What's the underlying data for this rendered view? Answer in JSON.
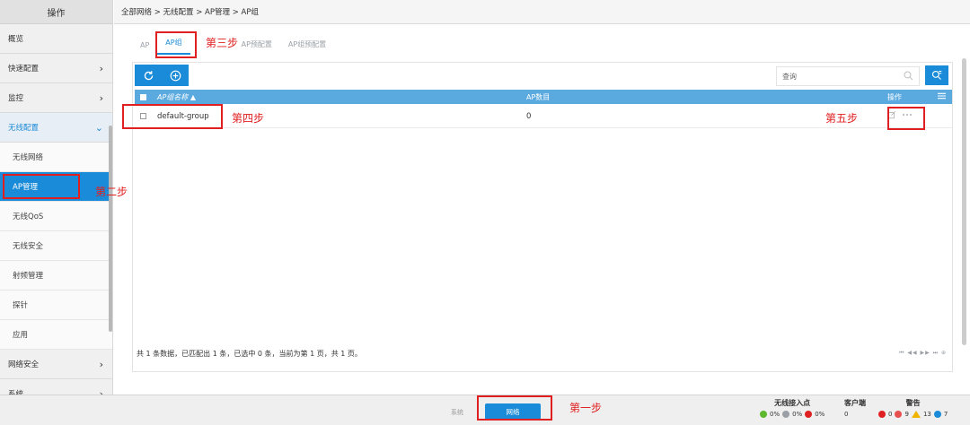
{
  "sidebar": {
    "header": "操作",
    "items": [
      {
        "label": "概览"
      },
      {
        "label": "快速配置",
        "chevron": "›"
      },
      {
        "label": "监控",
        "chevron": "›"
      },
      {
        "label": "无线配置",
        "chevron": "⌄"
      }
    ],
    "sub_items": [
      {
        "label": "无线网络"
      },
      {
        "label": "AP管理"
      },
      {
        "label": "无线QoS"
      },
      {
        "label": "无线安全"
      },
      {
        "label": "射频管理"
      },
      {
        "label": "探针"
      },
      {
        "label": "应用"
      }
    ],
    "bottom_items": [
      {
        "label": "网络安全",
        "chevron": "›"
      },
      {
        "label": "系统",
        "chevron": "›"
      }
    ]
  },
  "breadcrumb": "全部网络 > 无线配置 > AP管理 > AP组",
  "tabs": [
    "AP",
    "AP组",
    "AP预配置",
    "AP组预配置"
  ],
  "search": {
    "placeholder": "查询"
  },
  "table": {
    "headers": {
      "name": "AP组名称 ▲",
      "count": "AP数目",
      "ops": "操作"
    },
    "rows": [
      {
        "name": "default-group",
        "count": "0"
      }
    ]
  },
  "footer_info": "共 1 条数据，已匹配出 1 条，已选中 0 条，当前为第 1 页，共 1 页。",
  "pager": "⏮ ◀◀ ▶▶ ⏭ ⊕",
  "bottombar": {
    "system_label": "系统",
    "network_label": "网络",
    "wireless": {
      "title": "无线接入点",
      "green": "0%",
      "gray": "0%",
      "red": "0%"
    },
    "clients": {
      "title": "客户端",
      "value": "0"
    },
    "alarms": {
      "title": "警告",
      "red": "0",
      "orange": "9",
      "yellow": "13",
      "blue": "7"
    }
  },
  "annotations": {
    "step1": "第一步",
    "step2": "第二步",
    "step3": "第三步",
    "step4": "第四步",
    "step5": "第五步"
  },
  "colors": {
    "accent": "#1a8bd8",
    "annotation": "#e02020",
    "table_header": "#5aaae0"
  }
}
